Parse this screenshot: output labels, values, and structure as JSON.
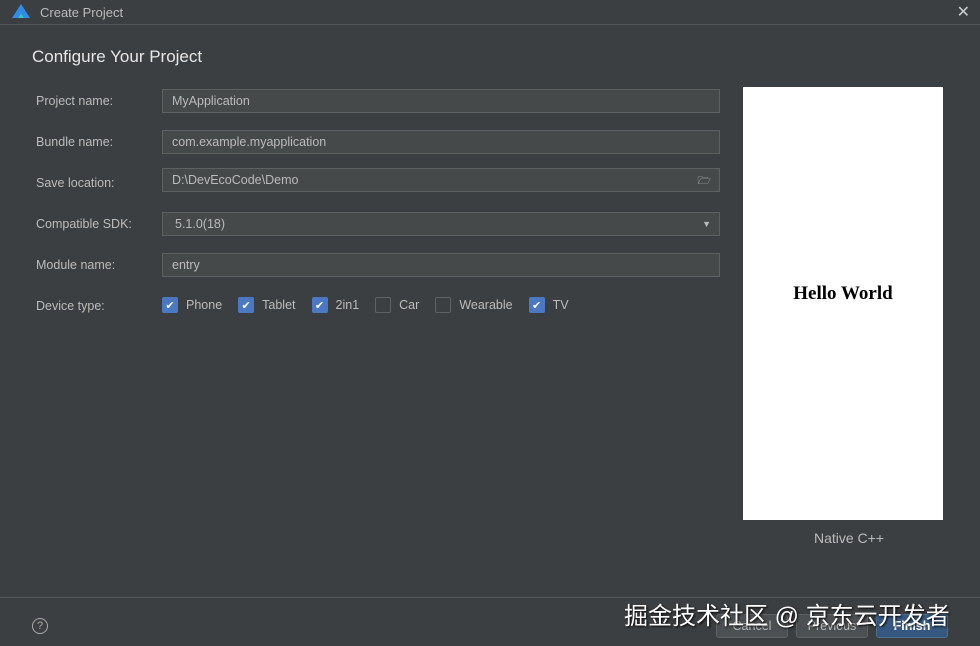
{
  "window": {
    "title": "Create Project"
  },
  "heading": "Configure Your Project",
  "form": {
    "project_name": {
      "label": "Project name:",
      "value": "MyApplication"
    },
    "bundle_name": {
      "label": "Bundle name:",
      "value": "com.example.myapplication"
    },
    "save_location": {
      "label": "Save location:",
      "value": "D:\\DevEcoCode\\Demo"
    },
    "compatible_sdk": {
      "label": "Compatible SDK:",
      "value": "5.1.0(18)"
    },
    "module_name": {
      "label": "Module name:",
      "value": "entry"
    },
    "device_type": {
      "label": "Device type:",
      "options": [
        {
          "label": "Phone",
          "checked": true
        },
        {
          "label": "Tablet",
          "checked": true
        },
        {
          "label": "2in1",
          "checked": true
        },
        {
          "label": "Car",
          "checked": false
        },
        {
          "label": "Wearable",
          "checked": false
        },
        {
          "label": "TV",
          "checked": true
        }
      ]
    }
  },
  "preview": {
    "content": "Hello World",
    "template_name": "Native C++"
  },
  "footer": {
    "help": "?",
    "cancel": "Cancel",
    "previous": "Previous",
    "finish": "Finish"
  },
  "watermark": "掘金技术社区 @ 京东云开发者",
  "colors": {
    "background": "#3c3f41",
    "accent": "#4a78c2",
    "primary_button": "#365880"
  }
}
